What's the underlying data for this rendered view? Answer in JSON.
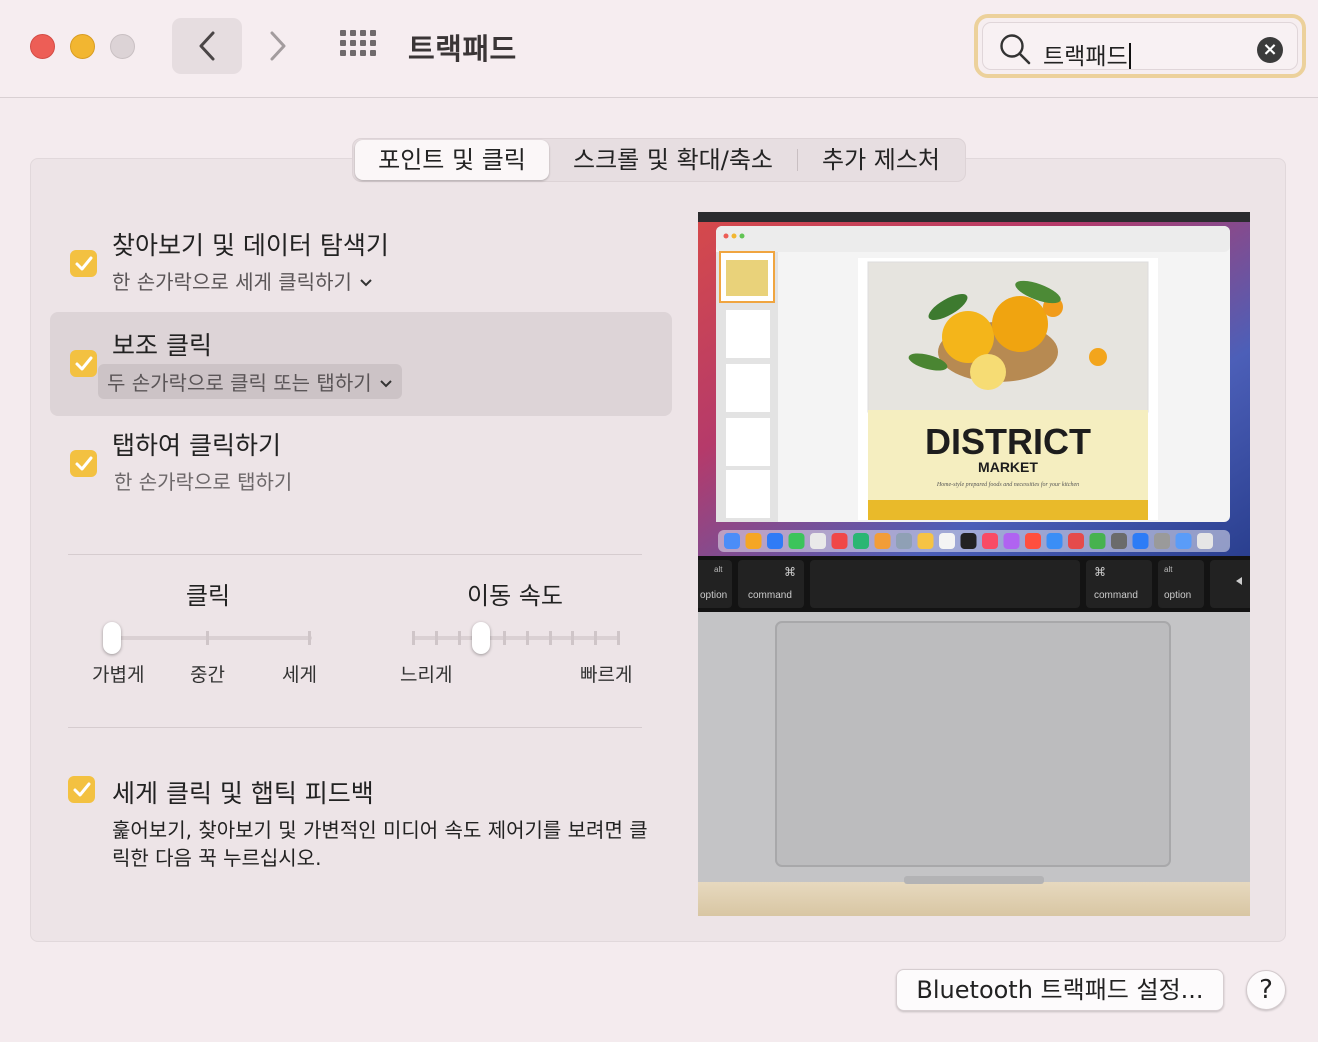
{
  "window": {
    "title": "트랙패드"
  },
  "search": {
    "value": "트랙패드",
    "placeholder": ""
  },
  "tabs": [
    {
      "label": "포인트 및 클릭",
      "active": true
    },
    {
      "label": "스크롤 및 확대/축소",
      "active": false
    },
    {
      "label": "추가 제스처",
      "active": false
    }
  ],
  "options": [
    {
      "title": "찾아보기 및 데이터 탐색기",
      "subtitle": "한 손가락으로 세게 클릭하기",
      "checked": true,
      "has_popup": true,
      "selected": false
    },
    {
      "title": "보조 클릭",
      "subtitle": "두 손가락으로 클릭 또는 탭하기",
      "checked": true,
      "has_popup": true,
      "selected": true
    },
    {
      "title": "탭하여 클릭하기",
      "subtitle": "한 손가락으로 탭하기",
      "checked": true,
      "has_popup": false,
      "selected": false
    }
  ],
  "click_slider": {
    "title": "클릭",
    "labels": [
      "가볍게",
      "중간",
      "세게"
    ],
    "value": "가볍게",
    "level": 0
  },
  "speed_slider": {
    "title": "이동 속도",
    "min_label": "느리게",
    "max_label": "빠르게",
    "level": 0.33
  },
  "force_click": {
    "title": "세게 클릭 및 햅틱 피드백",
    "checked": true,
    "description": "훑어보기, 찾아보기 및 가변적인 미디어 속도 제어기를 보려면 클릭한 다음 꾹 누르십시오."
  },
  "preview": {
    "doc_title": "DISTRICT",
    "doc_subtitle": "MARKET",
    "doc_tagline": "Home-style prepared foods and necessities for your kitchen",
    "keys": [
      "option",
      "command",
      "command",
      "option"
    ],
    "alt_label": "alt",
    "cmd_symbol": "⌘"
  },
  "buttons": {
    "bluetooth": "Bluetooth 트랙패드 설정...",
    "help": "?"
  },
  "colors": {
    "accent": "#f3c141",
    "search_focus": "#ecd19b",
    "background": "#f4ebee"
  }
}
